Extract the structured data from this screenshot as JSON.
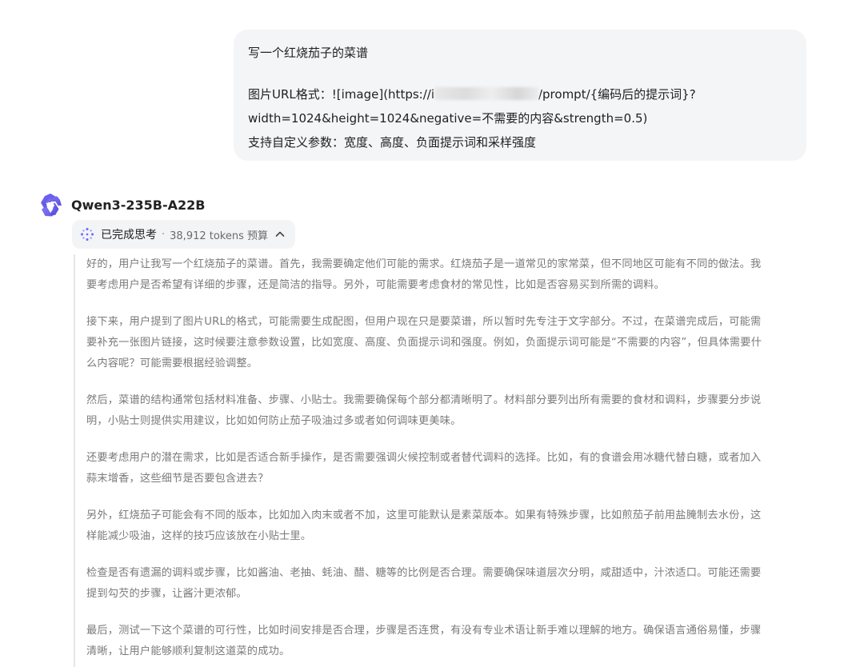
{
  "user_message": {
    "line1": "写一个红烧茄子的菜谱",
    "line2_prefix": "图片URL格式：![image](https://i",
    "line2_suffix": "/prompt/{编码后的提示词}?",
    "line3": "width=1024&height=1024&negative=不需要的内容&strength=0.5)",
    "line4": "支持自定义参数：宽度、高度、负面提示词和采样强度"
  },
  "model": {
    "name": "Qwen3-235B-A22B",
    "logo_icon": "qwen-logo-icon",
    "accent_color": "#615ced"
  },
  "thinking": {
    "status_label": "已完成思考",
    "separator": "·",
    "token_budget": "38,912 tokens 预算",
    "icon": "sparkle-dots-icon",
    "toggle_icon": "chevron-up-icon",
    "paragraphs": [
      [
        "好的，用户让我写一个红烧茄子的菜谱。首先，我需要确定他们可能的需求。红烧茄子是一道常见的家常菜，但不同地区可能有不同的做法。我",
        "要考虑用户是否希望有详细的步骤，还是简洁的指导。另外，可能需要考虑食材的常见性，比如是否容易买到所需的调料。"
      ],
      [
        "接下来，用户提到了图片URL的格式，可能需要生成配图，但用户现在只是要菜谱，所以暂时先专注于文字部分。不过，在菜谱完成后，可能需",
        "要补充一张图片链接，这时候要注意参数设置，比如宽度、高度、负面提示词和强度。例如，负面提示词可能是“不需要的内容”，但具体需要什",
        "么内容呢？可能需要根据经验调整。"
      ],
      [
        "然后，菜谱的结构通常包括材料准备、步骤、小贴士。我需要确保每个部分都清晰明了。材料部分要列出所有需要的食材和调料，步骤要分步说",
        "明，小贴士则提供实用建议，比如如何防止茄子吸油过多或者如何调味更美味。"
      ],
      [
        "还要考虑用户的潜在需求，比如是否适合新手操作，是否需要强调火候控制或者替代调料的选择。比如，有的食谱会用冰糖代替白糖，或者加入",
        "蒜末增香，这些细节是否要包含进去？"
      ],
      [
        "另外，红烧茄子可能会有不同的版本，比如加入肉末或者不加，这里可能默认是素菜版本。如果有特殊步骤，比如煎茄子前用盐腌制去水份，这",
        "样能减少吸油，这样的技巧应该放在小贴士里。"
      ],
      [
        "检查是否有遗漏的调料或步骤，比如酱油、老抽、蚝油、醋、糖等的比例是否合理。需要确保味道层次分明，咸甜适中，汁浓适口。可能还需要",
        "提到勾芡的步骤，让酱汁更浓郁。"
      ],
      [
        "最后，测试一下这个菜谱的可行性，比如时间安排是否合理，步骤是否连贯，有没有专业术语让新手难以理解的地方。确保语言通俗易懂，步骤",
        "清晰，让用户能够顺利复制这道菜的成功。"
      ]
    ]
  }
}
